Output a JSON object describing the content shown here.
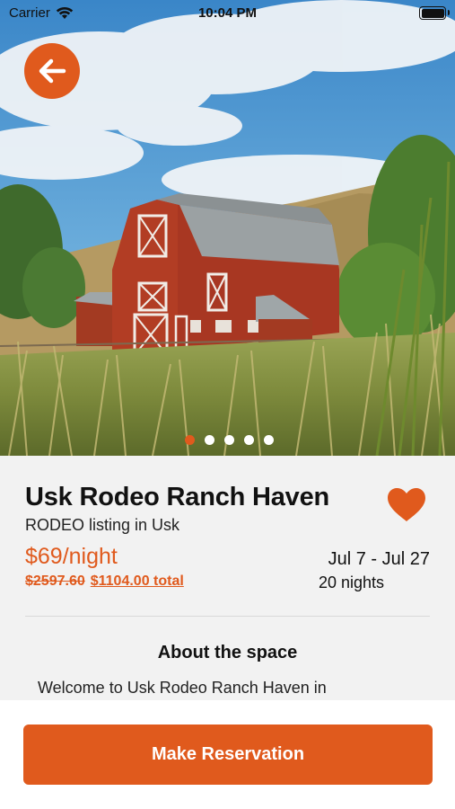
{
  "status_bar": {
    "carrier": "Carrier",
    "time": "10:04 PM"
  },
  "hero": {
    "image": "red-barn-photo",
    "carousel": {
      "count": 5,
      "active_index": 0
    }
  },
  "listing": {
    "title": "Usk Rodeo Ranch Haven",
    "subtitle": "RODEO listing in Usk",
    "price_per_night": "$69/night",
    "original_price": "$2597.60",
    "total_price": "$1104.00 total",
    "date_range": "Jul 7 - Jul 27",
    "nights": "20 nights",
    "favorited": true
  },
  "about": {
    "heading": "About the space",
    "text": "Welcome to Usk Rodeo Ranch Haven in"
  },
  "actions": {
    "reserve_label": "Make Reservation"
  },
  "colors": {
    "accent": "#e05a1d",
    "background": "#f2f2f2",
    "text": "#111111"
  },
  "icons": {
    "back": "arrow-left-icon",
    "favorite": "heart-icon",
    "wifi": "wifi-icon",
    "battery": "battery-icon"
  }
}
